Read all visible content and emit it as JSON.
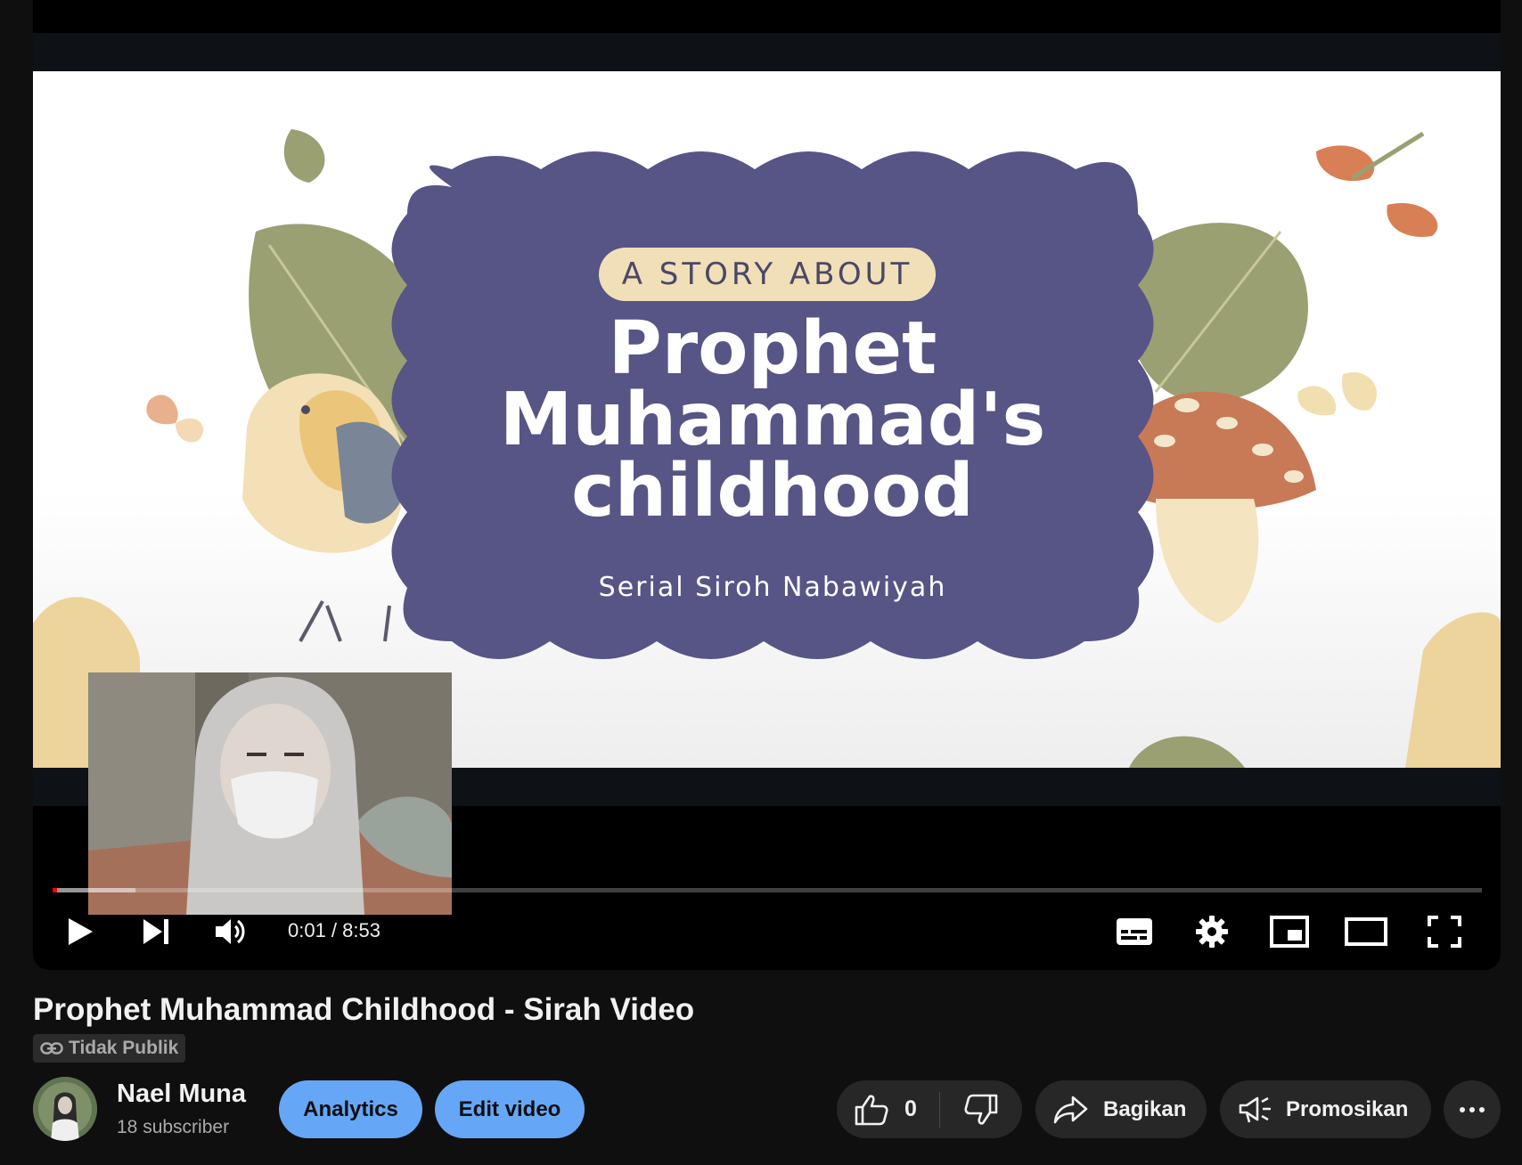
{
  "player": {
    "slide": {
      "tag": "A STORY ABOUT",
      "title_lines": [
        "Prophet",
        "Muhammad's",
        "childhood"
      ],
      "subtitle": "Serial Siroh Nabawiyah"
    },
    "progress": {
      "played_fraction": 0.003,
      "buffered_fraction": 0.058
    },
    "time_display": "0:01 / 8:53",
    "accent_color": "#ff0000"
  },
  "video": {
    "title": "Prophet Muhammad Childhood - Sirah Video",
    "visibility": "Tidak Publik"
  },
  "channel": {
    "name": "Nael Muna",
    "subscribers": "18 subscriber"
  },
  "actions": {
    "analytics": "Analytics",
    "edit_video": "Edit video",
    "like_count": "0",
    "share": "Bagikan",
    "promote": "Promosikan"
  },
  "icons": {
    "play": "play-icon",
    "next": "next-icon",
    "volume": "volume-icon",
    "subtitles": "subtitles-icon",
    "settings": "gear-icon",
    "miniplayer": "miniplayer-icon",
    "theater": "theater-icon",
    "fullscreen": "fullscreen-icon",
    "link": "link-icon",
    "like": "thumbs-up-icon",
    "dislike": "thumbs-down-icon",
    "share": "share-arrow-icon",
    "promote": "megaphone-icon",
    "more": "more-icon"
  }
}
